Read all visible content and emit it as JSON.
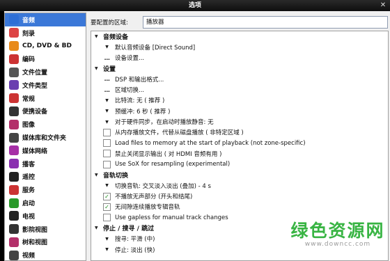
{
  "window": {
    "title": "选项"
  },
  "sidebar": {
    "items": [
      {
        "label": "音频",
        "icon": "note-icon",
        "color": "#2f6fd6",
        "selected": true
      },
      {
        "label": "刻录",
        "icon": "disc-icon",
        "color": "#d44"
      },
      {
        "label": "CD, DVD & BD",
        "icon": "cd-icon",
        "color": "#e88a1a"
      },
      {
        "label": "编码",
        "icon": "encode-icon",
        "color": "#c33"
      },
      {
        "label": "文件位置",
        "icon": "folder-doc-icon",
        "color": "#555"
      },
      {
        "label": "文件类型",
        "icon": "filetype-icon",
        "color": "#6a3fb0"
      },
      {
        "label": "常规",
        "icon": "general-icon",
        "color": "#c33"
      },
      {
        "label": "便携设备",
        "icon": "device-icon",
        "color": "#333"
      },
      {
        "label": "图像",
        "icon": "image-icon",
        "color": "#b3306a"
      },
      {
        "label": "媒体库和文件夹",
        "icon": "library-icon",
        "color": "#444"
      },
      {
        "label": "媒体网络",
        "icon": "network-icon",
        "color": "#a62fa6"
      },
      {
        "label": "播客",
        "icon": "podcast-icon",
        "color": "#8a2fb0"
      },
      {
        "label": "遥控",
        "icon": "remote-icon",
        "color": "#222"
      },
      {
        "label": "服务",
        "icon": "service-icon",
        "color": "#c33"
      },
      {
        "label": "启动",
        "icon": "power-icon",
        "color": "#2a9a2a"
      },
      {
        "label": "电视",
        "icon": "tv-icon",
        "color": "#222"
      },
      {
        "label": "影院视图",
        "icon": "theater-icon",
        "color": "#333"
      },
      {
        "label": "树和视图",
        "icon": "tree-icon",
        "color": "#b3306a"
      },
      {
        "label": "视频",
        "icon": "video-icon",
        "color": "#444"
      }
    ]
  },
  "zone": {
    "label": "要配置的区域:",
    "value": "播放器"
  },
  "panel": {
    "rows": [
      {
        "kind": "sec",
        "text": "音频设备",
        "chev": "▼"
      },
      {
        "kind": "opt",
        "mark": "caret",
        "text": "默认音频设备 [Direct Sound]"
      },
      {
        "kind": "opt",
        "mark": "dots",
        "text": "设备设置..."
      },
      {
        "kind": "sec",
        "text": "设置",
        "chev": "▼"
      },
      {
        "kind": "opt",
        "mark": "dots",
        "text": "DSP 和输出格式..."
      },
      {
        "kind": "opt",
        "mark": "dots",
        "text": "区域切换..."
      },
      {
        "kind": "opt",
        "mark": "caret",
        "text": "比特流: 无 ( 推荐 )"
      },
      {
        "kind": "opt",
        "mark": "caret",
        "text": "预缓冲: 6 秒 ( 推荐 )"
      },
      {
        "kind": "opt",
        "mark": "caret",
        "text": "对于硬件同步，在启动时播放静音: 无"
      },
      {
        "kind": "opt",
        "mark": "box",
        "checked": false,
        "text": "从内存播放文件，代替从磁盘播放 ( 非特定区域 )"
      },
      {
        "kind": "opt",
        "mark": "box",
        "checked": false,
        "text": "Load files to memory at the start of playback (not zone-specific)"
      },
      {
        "kind": "opt",
        "mark": "box",
        "checked": false,
        "text": "禁止关闭显示输出 ( 对 HDMI 音频有用 )"
      },
      {
        "kind": "opt",
        "mark": "box",
        "checked": false,
        "text": "Use SoX for resampling (experimental)"
      },
      {
        "kind": "sec",
        "text": "音轨切换",
        "chev": "▼"
      },
      {
        "kind": "opt",
        "mark": "caret",
        "text": "切换音轨: 交叉淡入淡出 (叠加) - 4 s"
      },
      {
        "kind": "opt",
        "mark": "box",
        "checked": true,
        "text": "不播放无声部分 (开头和结尾)"
      },
      {
        "kind": "opt",
        "mark": "box",
        "checked": true,
        "text": "无间隙连续播放专辑音轨"
      },
      {
        "kind": "opt",
        "mark": "box",
        "checked": false,
        "text": "Use gapless for manual track changes"
      },
      {
        "kind": "sec",
        "text": "停止 / 搜寻 / 跳过",
        "chev": "▼"
      },
      {
        "kind": "opt",
        "mark": "caret",
        "text": "搜寻: 平滑 (中)"
      },
      {
        "kind": "opt",
        "mark": "caret",
        "text": "停止: 淡出 (快)"
      }
    ]
  },
  "watermark": {
    "cn": "绿色资源网",
    "url": "www.downcc.com"
  }
}
